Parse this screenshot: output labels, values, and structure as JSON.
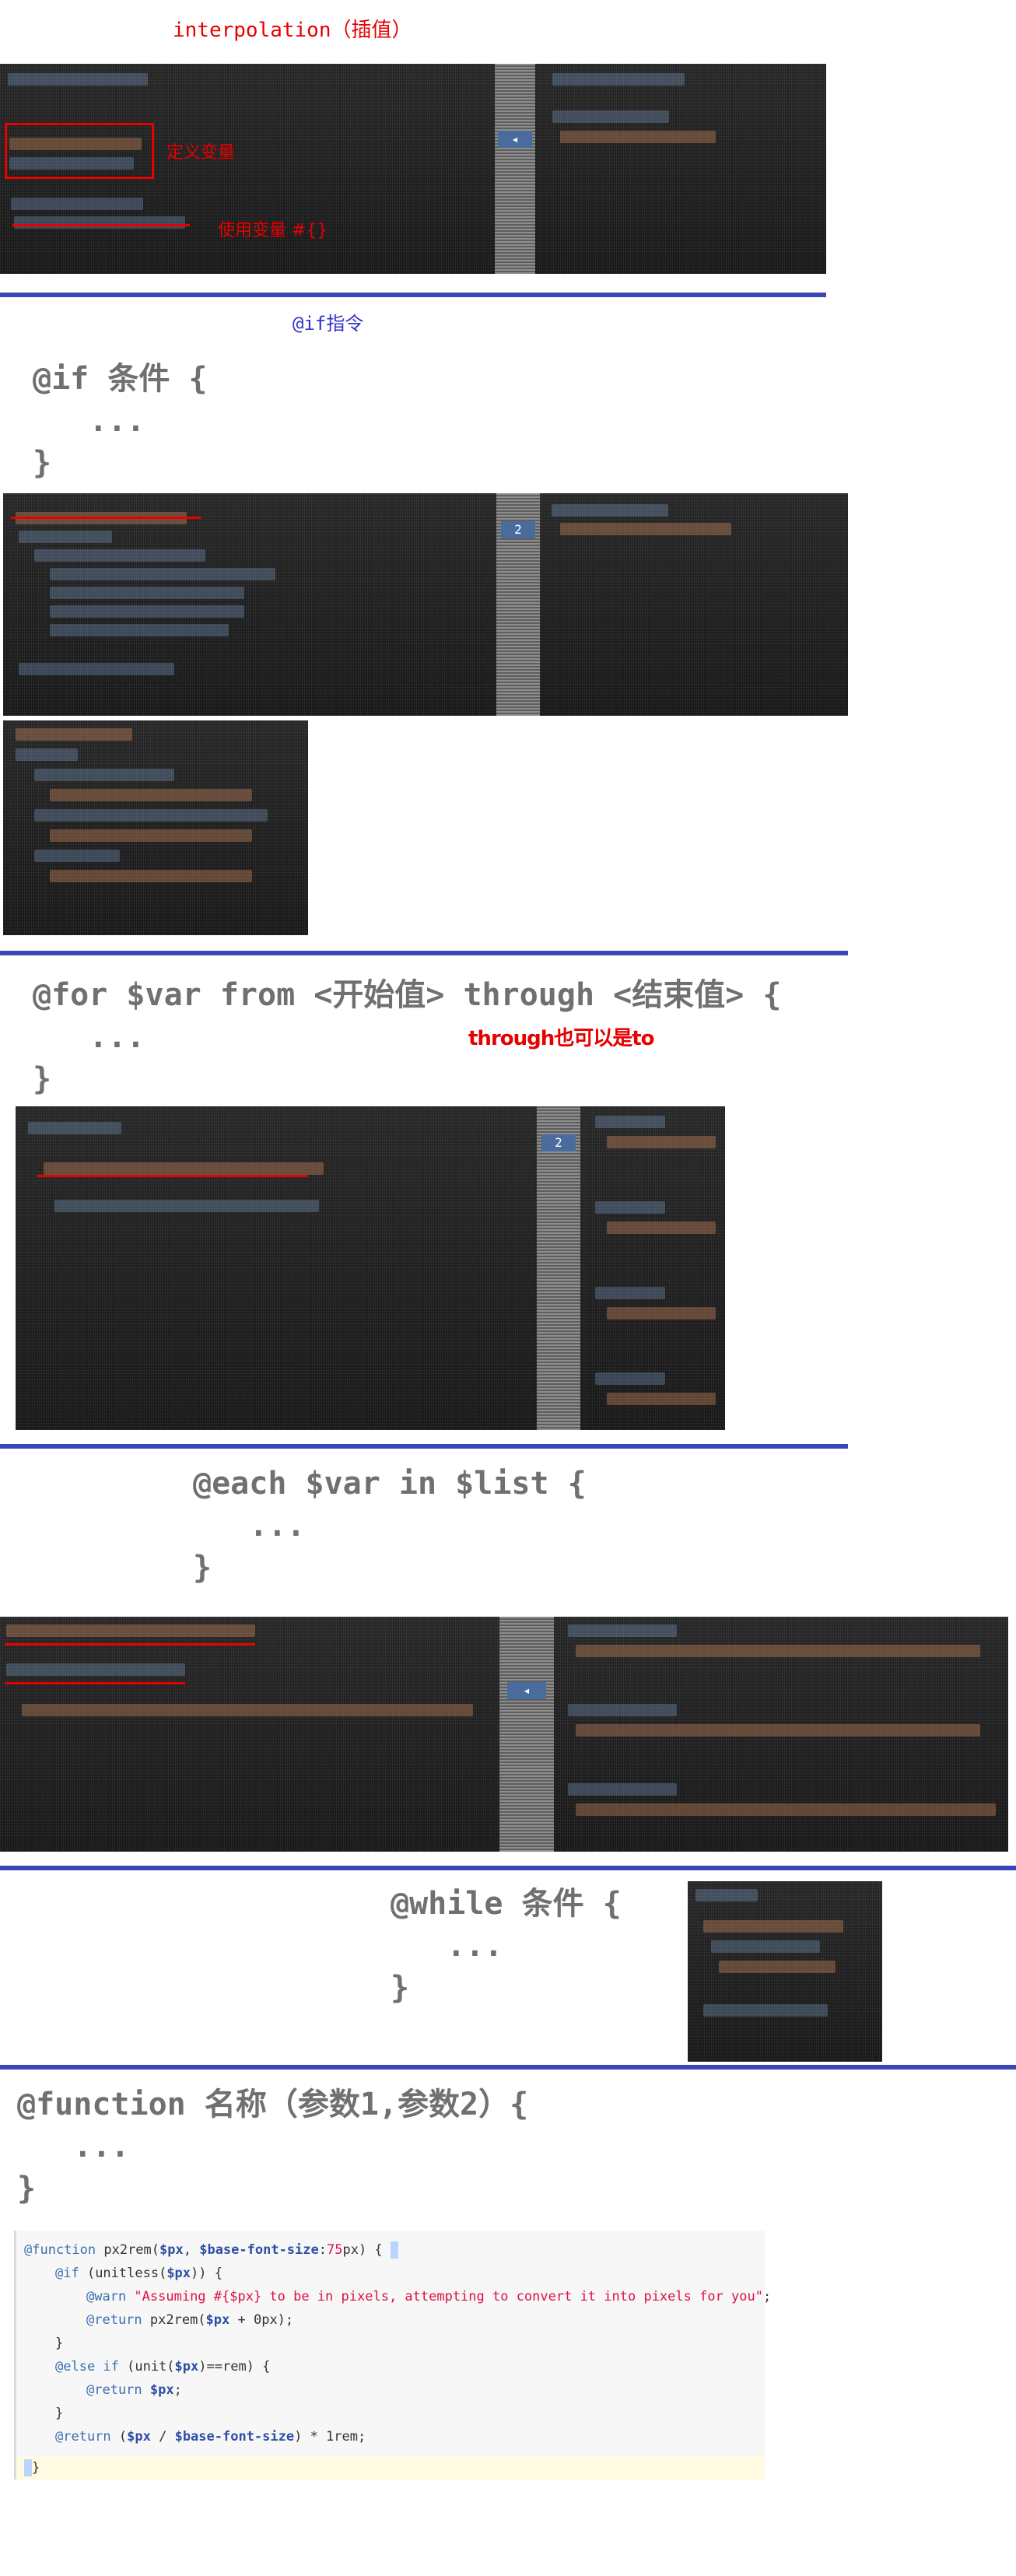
{
  "interpolation": {
    "title": "interpolation（插值）",
    "note_box": "定义变量",
    "note_underline": "使用变量  #{}"
  },
  "if_section": {
    "title": "@if指令",
    "code": [
      "@if 条件 {",
      "   ...",
      "}"
    ],
    "screenshot_line_num": "2"
  },
  "for_section": {
    "code": [
      "@for $var from <开始值> through <结束值> {",
      "   ...",
      "}"
    ],
    "note": "through也可以是to",
    "screenshot_line_num": "2"
  },
  "each_section": {
    "code": [
      "@each $var in $list {",
      "   ...",
      "}"
    ]
  },
  "while_section": {
    "code": [
      "@while 条件 {",
      "   ...",
      "}"
    ]
  },
  "function_section": {
    "code": [
      "@function 名称（参数1,参数2）{",
      "   ...",
      "}"
    ],
    "example": {
      "l1_kw": "@function",
      "l1_name": " px2rem(",
      "l1_var1": "$px",
      "l1_sep": ", ",
      "l1_var2": "$base-font-size",
      "l1_colon": ":",
      "l1_num": "75",
      "l1_end": "px) {",
      "l2_kw": "@if",
      "l2_rest_a": " (unitless(",
      "l2_var": "$px",
      "l2_rest_b": ")) {",
      "l3_kw": "@warn",
      "l3_str": " \"Assuming #{$px} to be in pixels, attempting to convert it into pixels for you\"",
      "l3_end": ";",
      "l4_kw": "@return",
      "l4_a": " px2rem(",
      "l4_var": "$px",
      "l4_b": " + 0px);",
      "l5": "}",
      "l6_kw": "@else if",
      "l6_a": " (unit(",
      "l6_var": "$px",
      "l6_b": ")==rem) {",
      "l7_kw": "@return",
      "l7_sp": " ",
      "l7_var": "$px",
      "l7_end": ";",
      "l8": "}",
      "l9_kw": "@return",
      "l9_a": " (",
      "l9_var1": "$px",
      "l9_b": " / ",
      "l9_var2": "$base-font-size",
      "l9_c": ") * 1rem;",
      "l10": "}"
    }
  }
}
